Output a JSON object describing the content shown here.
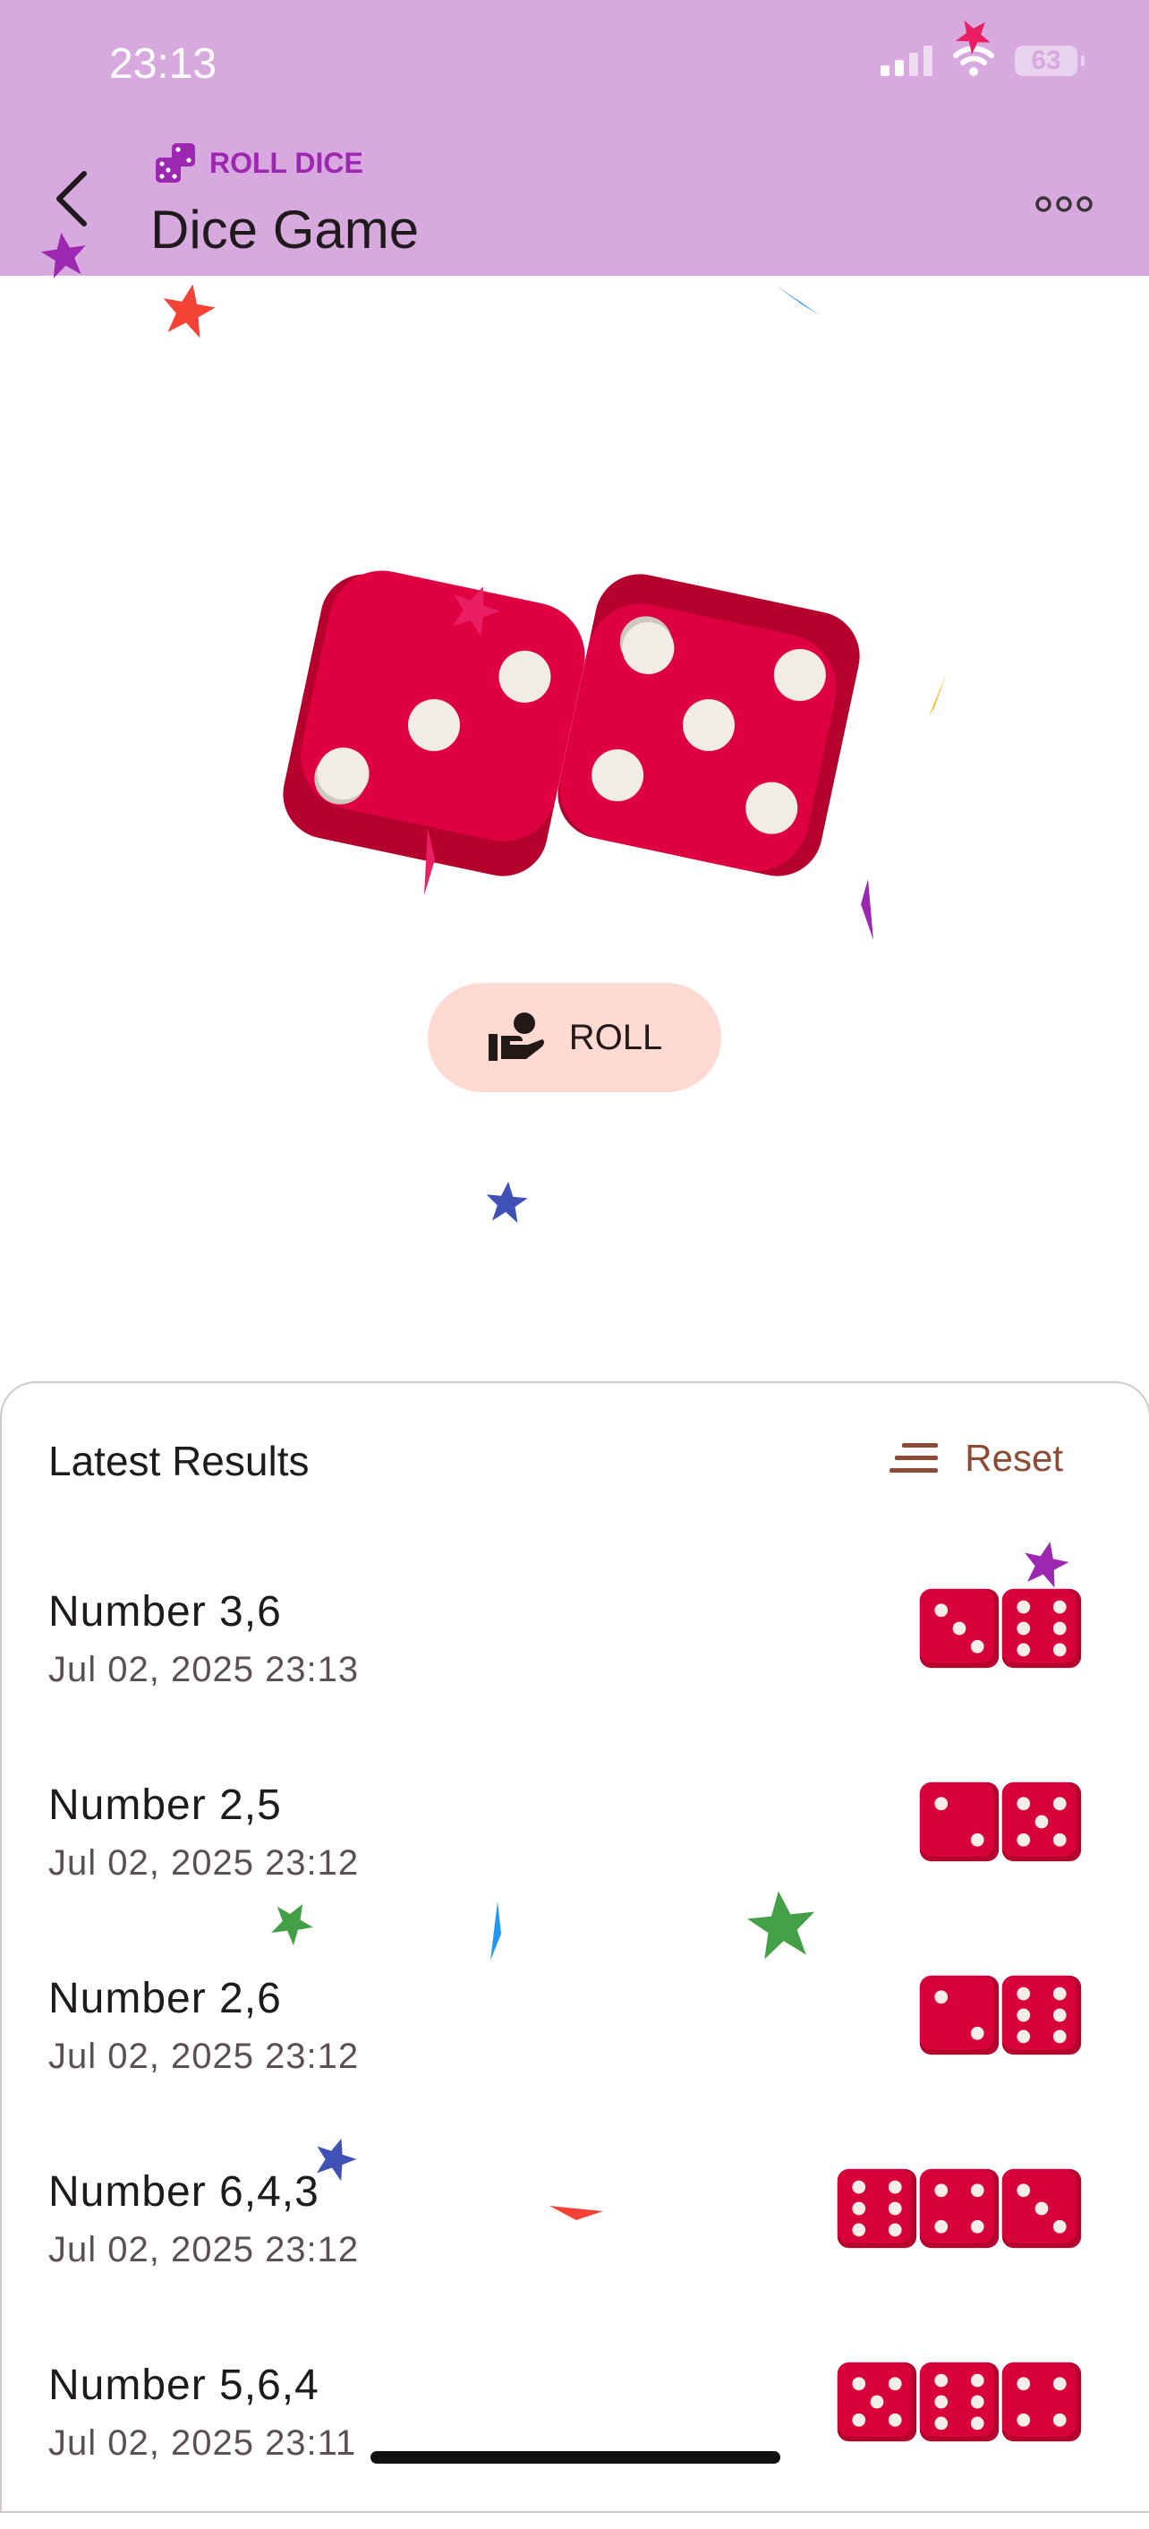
{
  "status": {
    "time": "23:13",
    "battery": "63"
  },
  "header": {
    "subtitle": "ROLL DICE",
    "title": "Dice Game"
  },
  "main": {
    "roll_label": "ROLL",
    "current_roll": [
      3,
      5
    ]
  },
  "results": {
    "title": "Latest Results",
    "reset_label": "Reset",
    "items": [
      {
        "label": "Number 3,6",
        "date": "Jul 02, 2025 23:13",
        "dice": [
          3,
          6
        ]
      },
      {
        "label": "Number 2,5",
        "date": "Jul 02, 2025 23:12",
        "dice": [
          2,
          5
        ]
      },
      {
        "label": "Number 2,6",
        "date": "Jul 02, 2025 23:12",
        "dice": [
          2,
          6
        ]
      },
      {
        "label": "Number 6,4,3",
        "date": "Jul 02, 2025 23:12",
        "dice": [
          6,
          4,
          3
        ]
      },
      {
        "label": "Number 5,6,4",
        "date": "Jul 02, 2025 23:11",
        "dice": [
          5,
          6,
          4
        ]
      }
    ]
  },
  "colors": {
    "appbar": "#d8a9df",
    "accent": "#9c27b0",
    "die": "#d8003a",
    "roll_button": "#ffdad2",
    "reset": "#8c4b35"
  }
}
